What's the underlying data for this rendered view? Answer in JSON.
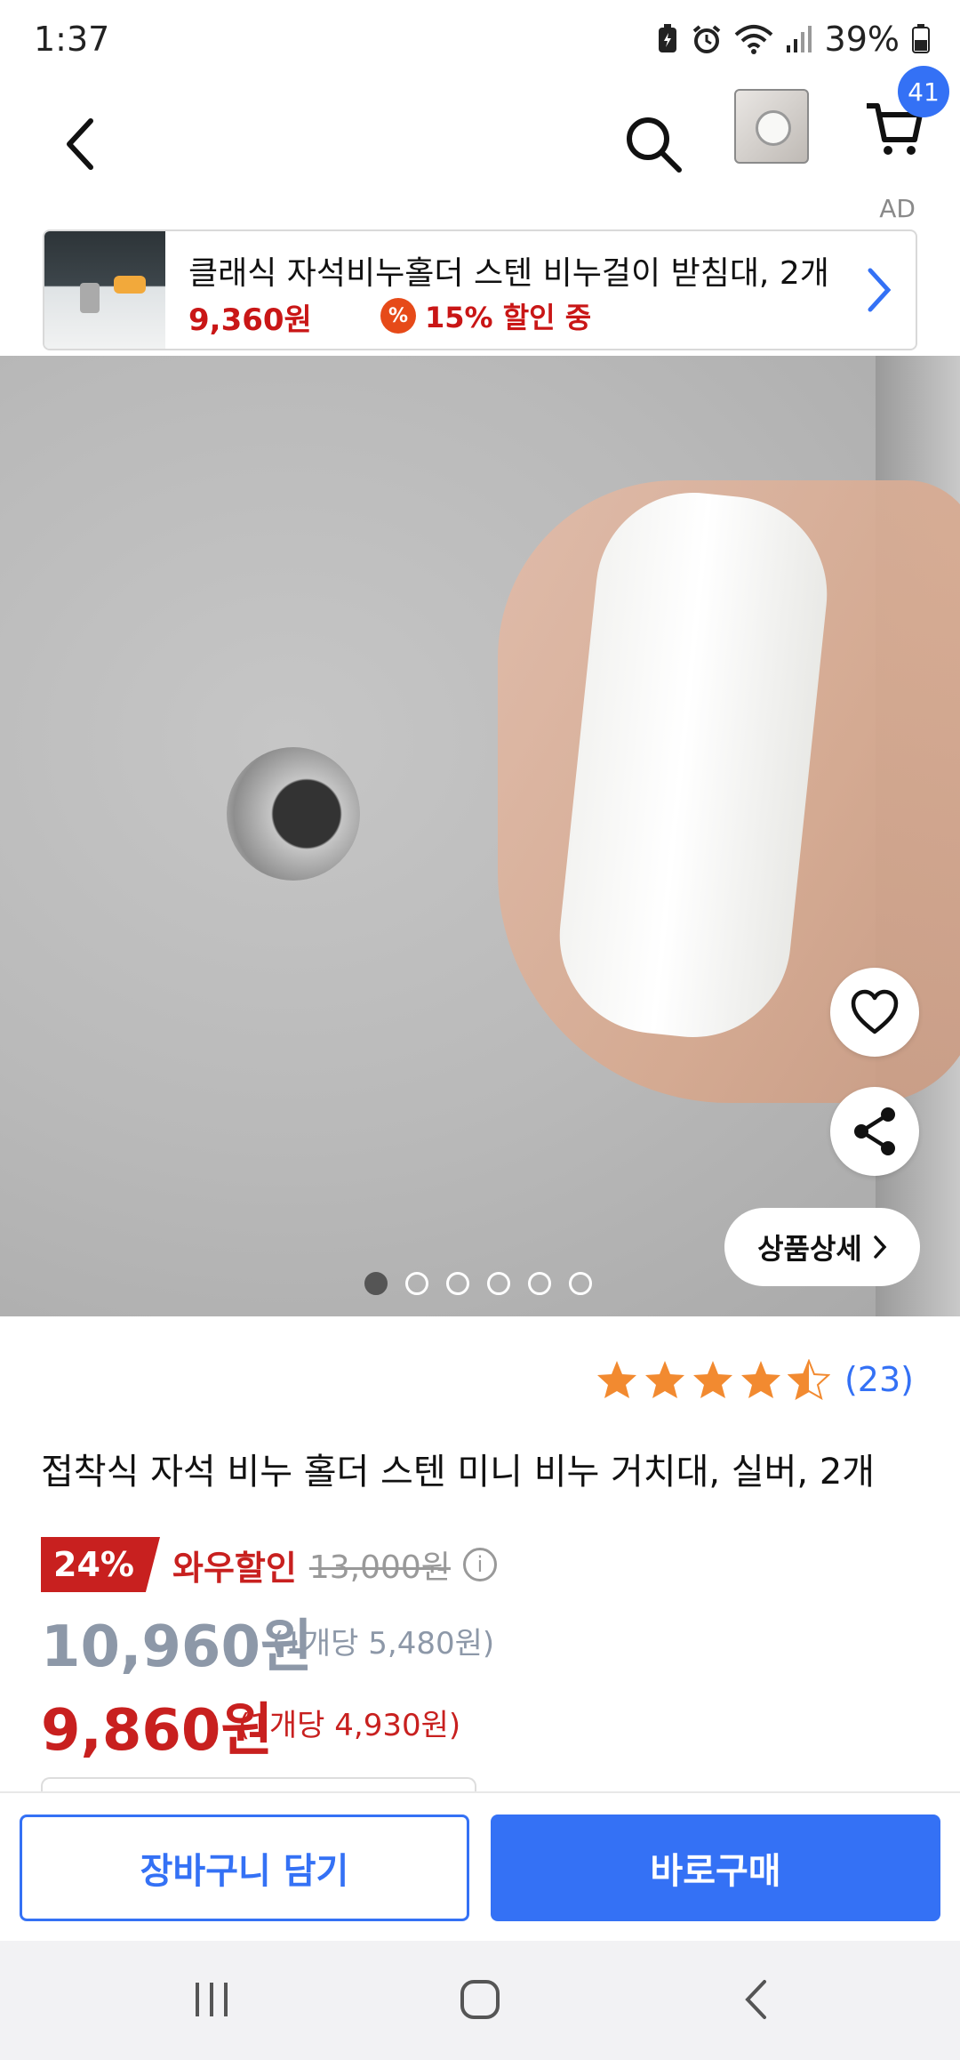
{
  "status_bar": {
    "time": "1:37",
    "battery": "39%"
  },
  "nav": {
    "cart_count": "41"
  },
  "ad": {
    "tag": "AD",
    "title": "클래식 자석비누홀더 스텐 비누걸이 받침대, 2개",
    "price": "9,360원",
    "discount_badge": "%",
    "discount": "15% 할인 중"
  },
  "hero": {
    "detail_label": "상품상세",
    "slide_count": 6,
    "active_slide": 1
  },
  "rating": {
    "stars": 4.5,
    "count": "(23)"
  },
  "product": {
    "title": "접착식 자석 비누 홀더 스텐 미니 비누 거치대, 실버, 2개",
    "discount_percent": "24%",
    "wow_label": "와우할인",
    "original_price": "13,000원",
    "price": "10,960원",
    "unit_price": "(1개당 5,480원)",
    "wow_price": "9,860원",
    "wow_unit_price": "(1개당 4,930원)"
  },
  "actions": {
    "add_to_cart": "장바구니 담기",
    "buy_now": "바로구매"
  },
  "colors": {
    "accent": "#3471f5",
    "sale": "#c8201f"
  }
}
